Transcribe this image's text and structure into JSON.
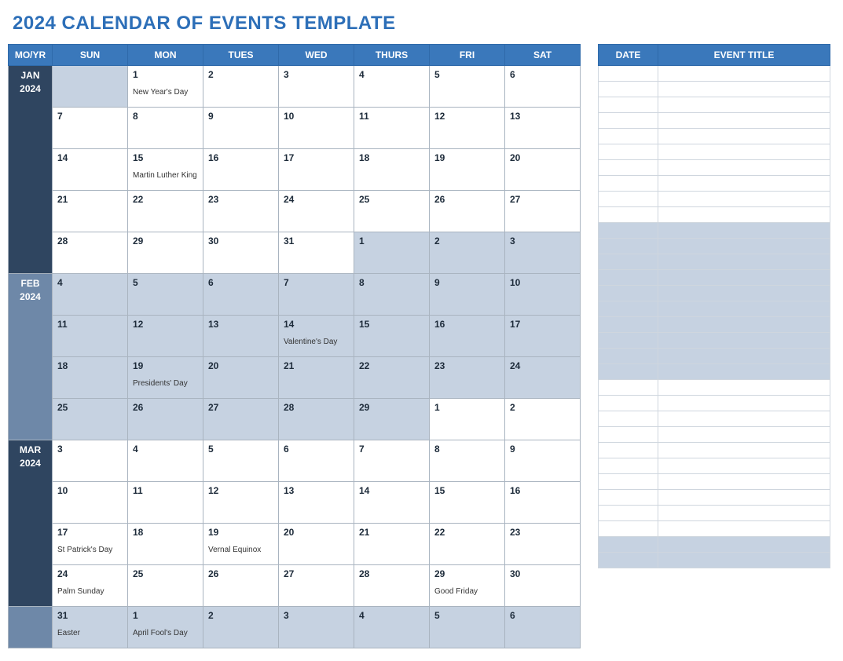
{
  "title": "2024 CALENDAR OF EVENTS TEMPLATE",
  "headers": {
    "moyr": "MO/YR",
    "days": [
      "SUN",
      "MON",
      "TUES",
      "WED",
      "THURS",
      "FRI",
      "SAT"
    ],
    "date": "DATE",
    "eventTitle": "EVENT TITLE"
  },
  "months": [
    {
      "id": "jan",
      "label": "JAN",
      "year": "2024",
      "cls": "mo-jan",
      "rows": 5,
      "weeks": [
        [
          {
            "d": "",
            "s": true
          },
          {
            "d": "1",
            "e": "New Year's Day"
          },
          {
            "d": "2"
          },
          {
            "d": "3"
          },
          {
            "d": "4"
          },
          {
            "d": "5"
          },
          {
            "d": "6"
          }
        ],
        [
          {
            "d": "7"
          },
          {
            "d": "8"
          },
          {
            "d": "9"
          },
          {
            "d": "10"
          },
          {
            "d": "11"
          },
          {
            "d": "12"
          },
          {
            "d": "13"
          }
        ],
        [
          {
            "d": "14"
          },
          {
            "d": "15",
            "e": "Martin Luther King Jr Day"
          },
          {
            "d": "16"
          },
          {
            "d": "17"
          },
          {
            "d": "18"
          },
          {
            "d": "19"
          },
          {
            "d": "20"
          }
        ],
        [
          {
            "d": "21"
          },
          {
            "d": "22"
          },
          {
            "d": "23"
          },
          {
            "d": "24"
          },
          {
            "d": "25"
          },
          {
            "d": "26"
          },
          {
            "d": "27"
          }
        ],
        [
          {
            "d": "28"
          },
          {
            "d": "29"
          },
          {
            "d": "30"
          },
          {
            "d": "31"
          },
          {
            "d": "1",
            "s": true
          },
          {
            "d": "2",
            "s": true
          },
          {
            "d": "3",
            "s": true
          }
        ]
      ]
    },
    {
      "id": "feb",
      "label": "FEB",
      "year": "2024",
      "cls": "mo-feb",
      "rows": 4,
      "weeks": [
        [
          {
            "d": "4",
            "s": true
          },
          {
            "d": "5",
            "s": true
          },
          {
            "d": "6",
            "s": true
          },
          {
            "d": "7",
            "s": true
          },
          {
            "d": "8",
            "s": true
          },
          {
            "d": "9",
            "s": true
          },
          {
            "d": "10",
            "s": true
          }
        ],
        [
          {
            "d": "11",
            "s": true
          },
          {
            "d": "12",
            "s": true
          },
          {
            "d": "13",
            "s": true
          },
          {
            "d": "14",
            "s": true,
            "e": "Valentine's Day"
          },
          {
            "d": "15",
            "s": true
          },
          {
            "d": "16",
            "s": true
          },
          {
            "d": "17",
            "s": true
          }
        ],
        [
          {
            "d": "18",
            "s": true
          },
          {
            "d": "19",
            "s": true,
            "e": "Presidents' Day"
          },
          {
            "d": "20",
            "s": true
          },
          {
            "d": "21",
            "s": true
          },
          {
            "d": "22",
            "s": true
          },
          {
            "d": "23",
            "s": true
          },
          {
            "d": "24",
            "s": true
          }
        ],
        [
          {
            "d": "25",
            "s": true
          },
          {
            "d": "26",
            "s": true
          },
          {
            "d": "27",
            "s": true
          },
          {
            "d": "28",
            "s": true
          },
          {
            "d": "29",
            "s": true
          },
          {
            "d": "1"
          },
          {
            "d": "2"
          }
        ]
      ]
    },
    {
      "id": "mar",
      "label": "MAR",
      "year": "2024",
      "cls": "mo-mar",
      "rows": 4,
      "weeks": [
        [
          {
            "d": "3"
          },
          {
            "d": "4"
          },
          {
            "d": "5"
          },
          {
            "d": "6"
          },
          {
            "d": "7"
          },
          {
            "d": "8"
          },
          {
            "d": "9"
          }
        ],
        [
          {
            "d": "10"
          },
          {
            "d": "11"
          },
          {
            "d": "12"
          },
          {
            "d": "13"
          },
          {
            "d": "14"
          },
          {
            "d": "15"
          },
          {
            "d": "16"
          }
        ],
        [
          {
            "d": "17",
            "e": "St Patrick's Day"
          },
          {
            "d": "18"
          },
          {
            "d": "19",
            "e": "Vernal Equinox"
          },
          {
            "d": "20"
          },
          {
            "d": "21"
          },
          {
            "d": "22"
          },
          {
            "d": "23"
          }
        ],
        [
          {
            "d": "24",
            "e": "Palm Sunday"
          },
          {
            "d": "25"
          },
          {
            "d": "26"
          },
          {
            "d": "27"
          },
          {
            "d": "28"
          },
          {
            "d": "29",
            "e": "Good Friday"
          },
          {
            "d": "30"
          }
        ]
      ]
    },
    {
      "id": "apr",
      "label": "",
      "year": "",
      "cls": "mo-apr",
      "rows": 1,
      "weeks": [
        [
          {
            "d": "31",
            "s": true,
            "e": "Easter"
          },
          {
            "d": "1",
            "s": true,
            "e": "April Fool's Day"
          },
          {
            "d": "2",
            "s": true
          },
          {
            "d": "3",
            "s": true
          },
          {
            "d": "4",
            "s": true
          },
          {
            "d": "5",
            "s": true
          },
          {
            "d": "6",
            "s": true
          }
        ]
      ]
    }
  ],
  "eventRows": [
    {
      "shade": false
    },
    {
      "shade": false
    },
    {
      "shade": false
    },
    {
      "shade": false
    },
    {
      "shade": false
    },
    {
      "shade": false
    },
    {
      "shade": false
    },
    {
      "shade": false
    },
    {
      "shade": false
    },
    {
      "shade": false
    },
    {
      "shade": true
    },
    {
      "shade": true
    },
    {
      "shade": true
    },
    {
      "shade": true
    },
    {
      "shade": true
    },
    {
      "shade": true
    },
    {
      "shade": true
    },
    {
      "shade": true
    },
    {
      "shade": true
    },
    {
      "shade": true
    },
    {
      "shade": false
    },
    {
      "shade": false
    },
    {
      "shade": false
    },
    {
      "shade": false
    },
    {
      "shade": false
    },
    {
      "shade": false
    },
    {
      "shade": false
    },
    {
      "shade": false
    },
    {
      "shade": false
    },
    {
      "shade": false
    },
    {
      "shade": true
    },
    {
      "shade": true
    }
  ]
}
